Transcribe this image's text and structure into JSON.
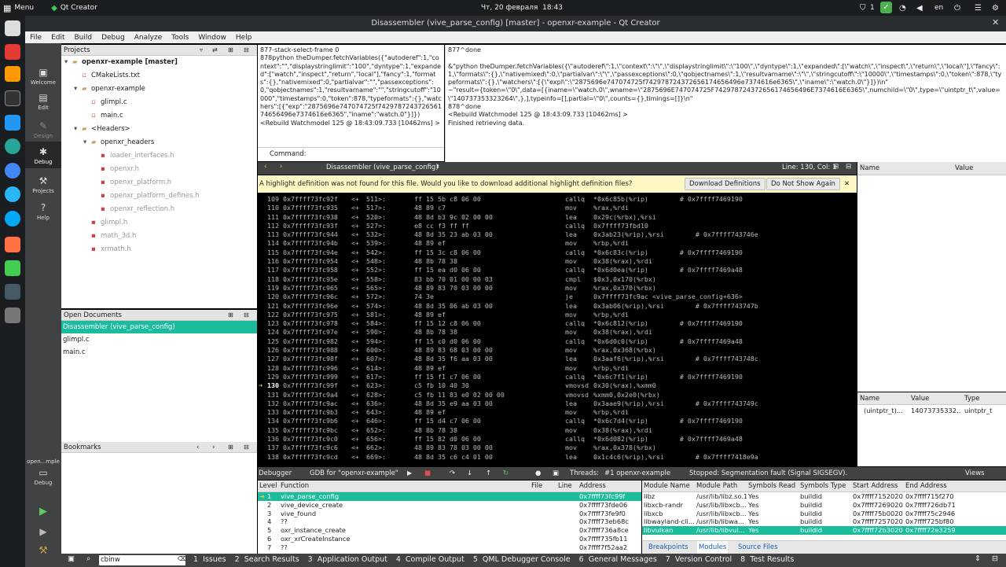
{
  "system": {
    "menu": "Menu",
    "app": "Qt Creator",
    "datetime": "Чт, 20 февраля  18:43",
    "notif": "1",
    "lang": "en"
  },
  "window_title": "Disassembler (vive_parse_config) [master] - openxr-example - Qt Creator",
  "menu": [
    "File",
    "Edit",
    "Build",
    "Debug",
    "Analyze",
    "Tools",
    "Window",
    "Help"
  ],
  "modes": [
    "Welcome",
    "Edit",
    "Design",
    "Debug",
    "Projects",
    "Help"
  ],
  "projects": {
    "header": "Projects",
    "items": [
      {
        "t": "openxr-example [master]",
        "ind": 0,
        "arrow": "▾",
        "bold": true,
        "grey": false
      },
      {
        "t": "CMakeLists.txt",
        "ind": 1,
        "arrow": "",
        "bold": false,
        "grey": false
      },
      {
        "t": "openxr-example",
        "ind": 1,
        "arrow": "▾",
        "bold": false,
        "grey": false
      },
      {
        "t": "glimpl.c",
        "ind": 2,
        "arrow": "",
        "bold": false,
        "grey": false
      },
      {
        "t": "main.c",
        "ind": 2,
        "arrow": "",
        "bold": false,
        "grey": false
      },
      {
        "t": "<Headers>",
        "ind": 1,
        "arrow": "▾",
        "bold": false,
        "grey": false
      },
      {
        "t": "openxr_headers",
        "ind": 2,
        "arrow": "▾",
        "bold": false,
        "grey": false
      },
      {
        "t": "loader_interfaces.h",
        "ind": 3,
        "arrow": "",
        "bold": false,
        "grey": true
      },
      {
        "t": "openxr.h",
        "ind": 3,
        "arrow": "",
        "bold": false,
        "grey": true
      },
      {
        "t": "openxr_platform.h",
        "ind": 3,
        "arrow": "",
        "bold": false,
        "grey": true
      },
      {
        "t": "openxr_platform_defines.h",
        "ind": 3,
        "arrow": "",
        "bold": false,
        "grey": true
      },
      {
        "t": "openxr_reflection.h",
        "ind": 3,
        "arrow": "",
        "bold": false,
        "grey": true
      },
      {
        "t": "glimpl.h",
        "ind": 2,
        "arrow": "",
        "bold": false,
        "grey": true
      },
      {
        "t": "math_3d.h",
        "ind": 2,
        "arrow": "",
        "bold": false,
        "grey": true
      },
      {
        "t": "xrmath.h",
        "ind": 2,
        "arrow": "",
        "bold": false,
        "grey": true
      }
    ]
  },
  "open_documents": {
    "header": "Open Documents",
    "items": [
      "Disassembler (vive_parse_config)",
      "glimpl.c",
      "main.c"
    ]
  },
  "bookmarks": {
    "header": "Bookmarks"
  },
  "kit": {
    "name": "open...mple",
    "mode": "Debug"
  },
  "log_left": "877-stack-select-frame 0\n878python theDumper.fetchVariables({\"autoderef\":1,\"context\":\"\",\"displaystringlimit\":\"100\",\"dyntype\":1,\"expanded\":[\"watch\",\"inspect\",\"return\",\"local\"],\"fancy\":1,\"formats\":{},\"nativemixed\":0,\"partialvar\":\"\",\"passexceptions\":0,\"qobjectnames\":1,\"resultvarname\":\"\",\"stringcutoff\":\"10000\",\"timestamps\":0,\"token\":878,\"typeformats\":{},\"watchers\":[{\"exp\":\"2875696e747074725f742978724372656174656496e7374616e6365\",\"iname\":\"watch.0\"}]})\n<Rebuild Watchmodel 125 @ 18:43:09.733 [10462ms] >",
  "command_label": "Command:",
  "log_right": "877^done\n\n&\"python theDumper.fetchVariables({\\\"autoderef\\\":1,\\\"context\\\":\\\"\\\",\\\"displaystringlimit\\\":\\\"100\\\",\\\"dyntype\\\":1,\\\"expanded\\\":[\\\"watch\\\",\\\"inspect\\\",\\\"return\\\",\\\"local\\\"],\\\"fancy\\\":1,\\\"formats\\\":{},\\\"nativemixed\\\":0,\\\"partialvar\\\":\\\"\\\",\\\"passexceptions\\\":0,\\\"qobjectnames\\\":1,\\\"resultvarname\\\":\\\"\\\",\\\"stringcutoff\\\":\\\"10000\\\",\\\"timestamps\\\":0,\\\"token\\\":878,\\\"typeformats\\\":{},\\\"watchers\\\":[{\\\"expl\\\":\\\"2875696e747074725f742978724372656174656496e7374616e6365\\\",\\\"iname\\\":\\\"watch.0\\\"}]})\\n\"\n~\"result={token=\\\"0\\\",data=[{iname=\\\"watch.0\\\",wname=\\\"2875696E747074725F742978724372656174656496E7374616E6365\\\",numchild=\\\"0\\\",type=\\\"uintptr_t\\\",value=\\\"140737353323264\\\",},],typeinfo=[],partial=\\\"0\\\",counts={},timings=[]}\\n\"\n878^done\n<Rebuild Watchmodel 125 @ 18:43:09.733 [10462ms] >\nFinished retrieving data.",
  "editor": {
    "tab": "Disassembler (vive_parse_config)",
    "position": "Line: 130, Col: 1",
    "banner": "A highlight definition was not found for this file. Would you like to download additional highlight definition files?",
    "download": "Download Definitions",
    "dont_show": "Do Not Show Again",
    "current_line": "130",
    "lines": [
      [
        "109",
        "0x7ffff73fc92f",
        "<+",
        "511>:",
        "ff 15 5b c8 06 00",
        "callq",
        "*0x6c85b(%rip)        # 0x7ffff7469190"
      ],
      [
        "110",
        "0x7ffff73fc935",
        "<+",
        "517>:",
        "48 89 c7",
        "mov",
        "%rax,%rdi"
      ],
      [
        "111",
        "0x7ffff73fc938",
        "<+",
        "520>:",
        "48 8d b3 9c 02 00 00",
        "lea",
        "0x29c(%rbx),%rsi"
      ],
      [
        "112",
        "0x7ffff73fc93f",
        "<+",
        "527>:",
        "e8 cc f3 ff ff",
        "callq",
        "0x7ffff73fbd10"
      ],
      [
        "113",
        "0x7ffff73fc944",
        "<+",
        "532>:",
        "48 8d 35 23 ab 03 00",
        "lea",
        "0x3ab23(%rip),%rsi        # 0x7ffff743746e"
      ],
      [
        "114",
        "0x7ffff73fc94b",
        "<+",
        "539>:",
        "48 89 ef",
        "mov",
        "%rbp,%rdi"
      ],
      [
        "115",
        "0x7ffff73fc94e",
        "<+",
        "542>:",
        "ff 15 3c c8 06 00",
        "callq",
        "*0x6c83c(%rip)        # 0x7ffff7469190"
      ],
      [
        "116",
        "0x7ffff73fc954",
        "<+",
        "548>:",
        "48 8b 78 38",
        "mov",
        "0x38(%rax),%rdi"
      ],
      [
        "117",
        "0x7ffff73fc958",
        "<+",
        "552>:",
        "ff 15 ea d0 06 00",
        "callq",
        "*0x6d0ea(%rip)        # 0x7ffff7469a48"
      ],
      [
        "118",
        "0x7ffff73fc95e",
        "<+",
        "558>:",
        "83 bb 70 01 00 00 03",
        "cmpl",
        "$0x3,0x170(%rbx)"
      ],
      [
        "119",
        "0x7ffff73fc965",
        "<+",
        "565>:",
        "48 89 83 70 03 00 00",
        "mov",
        "%rax,0x370(%rbx)"
      ],
      [
        "120",
        "0x7ffff73fc96c",
        "<+",
        "572>:",
        "74 3e",
        "je",
        "0x7ffff73fc9ac <vive_parse_config+636>"
      ],
      [
        "121",
        "0x7ffff73fc96e",
        "<+",
        "574>:",
        "48 8d 35 06 ab 03 00",
        "lea",
        "0x3ab06(%rip),%rsi        # 0x7ffff743747b"
      ],
      [
        "122",
        "0x7ffff73fc975",
        "<+",
        "581>:",
        "48 89 ef",
        "mov",
        "%rbp,%rdi"
      ],
      [
        "123",
        "0x7ffff73fc978",
        "<+",
        "584>:",
        "ff 15 12 c8 06 00",
        "callq",
        "*0x6c812(%rip)        # 0x7ffff7469190"
      ],
      [
        "124",
        "0x7ffff73fc97e",
        "<+",
        "590>:",
        "48 8b 78 38",
        "mov",
        "0x38(%rax),%rdi"
      ],
      [
        "125",
        "0x7ffff73fc982",
        "<+",
        "594>:",
        "ff 15 c0 d0 06 00",
        "callq",
        "*0x6d0c0(%rip)        # 0x7ffff7469a48"
      ],
      [
        "126",
        "0x7ffff73fc988",
        "<+",
        "600>:",
        "48 89 83 68 03 00 00",
        "mov",
        "%rax,0x368(%rbx)"
      ],
      [
        "127",
        "0x7ffff73fc98f",
        "<+",
        "607>:",
        "48 8d 35 f6 aa 03 00",
        "lea",
        "0x3aaf6(%rip),%rsi        # 0x7ffff743748c"
      ],
      [
        "128",
        "0x7ffff73fc996",
        "<+",
        "614>:",
        "48 89 ef",
        "mov",
        "%rbp,%rdi"
      ],
      [
        "129",
        "0x7ffff73fc999",
        "<+",
        "617>:",
        "ff 15 f1 c7 06 00",
        "callq",
        "*0x6c7f1(%rip)        # 0x7ffff7469190"
      ],
      [
        "130",
        "0x7ffff73fc99f",
        "<+",
        "623>:",
        "c5 fb 10 40 30",
        "vmovsd",
        "0x30(%rax),%xmm0"
      ],
      [
        "131",
        "0x7ffff73fc9a4",
        "<+",
        "628>:",
        "c5 fb 11 83 e0 02 00 00",
        "vmovsd",
        "%xmm0,0x2e0(%rbx)"
      ],
      [
        "132",
        "0x7ffff73fc9ac",
        "<+",
        "636>:",
        "48 8d 35 e9 aa 03 00",
        "lea",
        "0x3aae9(%rip),%rsi        # 0x7ffff743749c"
      ],
      [
        "133",
        "0x7ffff73fc9b3",
        "<+",
        "643>:",
        "48 89 ef",
        "mov",
        "%rbp,%rdi"
      ],
      [
        "134",
        "0x7ffff73fc9b6",
        "<+",
        "646>:",
        "ff 15 d4 c7 06 00",
        "callq",
        "*0x6c7d4(%rip)        # 0x7ffff7469190"
      ],
      [
        "135",
        "0x7ffff73fc9bc",
        "<+",
        "652>:",
        "48 8b 78 38",
        "mov",
        "0x38(%rax),%rdi"
      ],
      [
        "136",
        "0x7ffff73fc9c0",
        "<+",
        "656>:",
        "ff 15 82 d0 06 00",
        "callq",
        "*0x6d082(%rip)        # 0x7ffff7469a48"
      ],
      [
        "137",
        "0x7ffff73fc9c6",
        "<+",
        "662>:",
        "48 89 83 78 03 00 00",
        "mov",
        "%rax,0x378(%rbx)"
      ],
      [
        "138",
        "0x7ffff73fc9cd",
        "<+",
        "669>:",
        "48 8d 35 c6 c4 01 00",
        "lea",
        "0x1c4c6(%rip),%rsi        # 0x7ffff7418e9a"
      ]
    ]
  },
  "locals": {
    "headers": [
      "Name",
      "Value"
    ]
  },
  "watch": {
    "headers": [
      "Name",
      "Value",
      "Type"
    ],
    "row": [
      "(uintptr_t)...",
      "14073735332...",
      "uintptr_t"
    ]
  },
  "debugger": {
    "label": "Debugger",
    "engine": "GDB for \"openxr-example\"",
    "threads_label": "Threads:",
    "thread": "#1 openxr-example",
    "status": "Stopped: Segmentation fault (Signal SIGSEGV).",
    "views": "Views"
  },
  "stack": {
    "headers": [
      "Level",
      "Function",
      "File",
      "Line",
      "Address"
    ],
    "rows": [
      [
        "1",
        "vive_parse_config",
        "",
        "",
        "0x7ffff73fc99f"
      ],
      [
        "2",
        "vive_device_create",
        "",
        "",
        "0x7ffff73fde06"
      ],
      [
        "3",
        "vive_found",
        "",
        "",
        "0x7ffff73fe9f0"
      ],
      [
        "4",
        "??",
        "",
        "",
        "0x7ffff73eb68c"
      ],
      [
        "5",
        "oxr_instance_create",
        "",
        "",
        "0x7ffff736a8ce"
      ],
      [
        "6",
        "oxr_xrCreateInstance",
        "",
        "",
        "0x7ffff735fb11"
      ],
      [
        "7",
        "??",
        "",
        "",
        "0x7ffff7f52aa2"
      ]
    ]
  },
  "modules": {
    "headers": [
      "Module Name",
      "Module Path",
      "Symbols Read",
      "Symbols Type",
      "Start Address",
      "End Address"
    ],
    "rows": [
      [
        "libz",
        "/usr/lib/libz.so.1",
        "Yes",
        "buildid",
        "0x7ffff7152020",
        "0x7ffff715f270"
      ],
      [
        "libxcb-randr",
        "/usr/lib/libxcb...",
        "Yes",
        "buildid",
        "0x7ffff7269020",
        "0x7ffff726db71"
      ],
      [
        "libxcb",
        "/usr/lib/libxcb...",
        "Yes",
        "buildid",
        "0x7ffff75b0020",
        "0x7ffff75c2946"
      ],
      [
        "libwayland-cli...",
        "/usr/lib/libwa...",
        "Yes",
        "buildid",
        "0x7ffff7257020",
        "0x7ffff725bf80"
      ],
      [
        "libvulkan",
        "/usr/lib/libvul...",
        "Yes",
        "buildid",
        "0x7ffff72b3020",
        "0x7ffff72e3259"
      ]
    ],
    "tabs": [
      "Breakpoints",
      "Modules",
      "Source Files"
    ]
  },
  "statusbar": {
    "search": "cbinw",
    "items": [
      "1  Issues",
      "2  Search Results",
      "3  Application Output",
      "4  Compile Output",
      "5  QML Debugger Console",
      "6  General Messages",
      "7  Version Control",
      "8  Test Results"
    ]
  }
}
